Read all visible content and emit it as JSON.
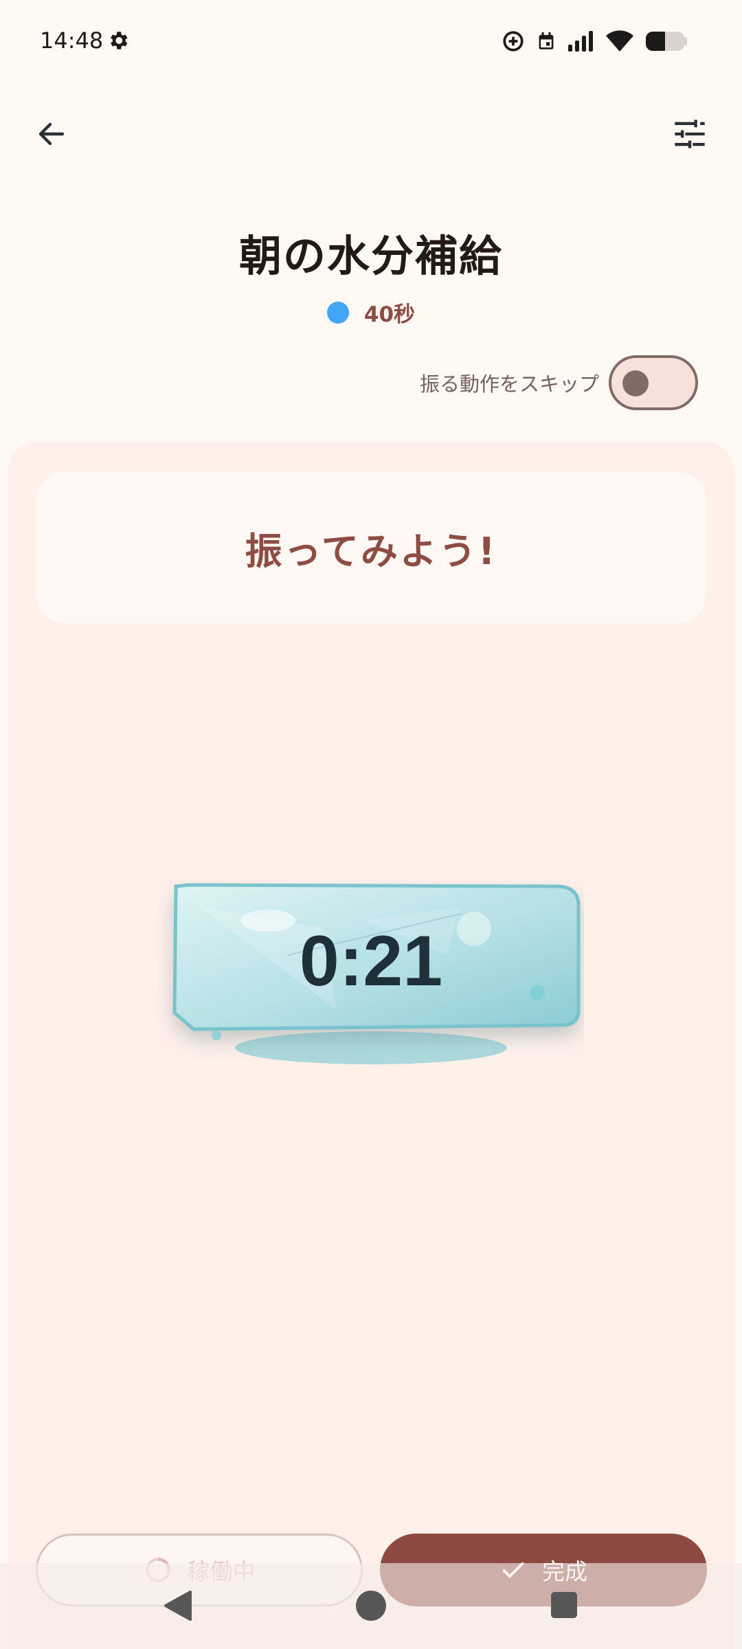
{
  "status_bar": {
    "time": "14:48"
  },
  "header": {
    "back_icon": "arrow-left-icon",
    "settings_icon": "tune-sliders-icon"
  },
  "title": "朝の水分補給",
  "duration": {
    "label": "40秒",
    "dot_color": "#42A5F5"
  },
  "skip": {
    "label": "振る動作をスキップ",
    "enabled": false
  },
  "prompt": "振ってみよう!",
  "timer": {
    "display": "0:21"
  },
  "actions": {
    "running_label": "稼働中",
    "complete_label": "完成"
  },
  "colors": {
    "background": "#FFF8F3",
    "panel": "#FFF0EA",
    "accent": "#8D4A41",
    "ice": "#9FD6DD"
  }
}
